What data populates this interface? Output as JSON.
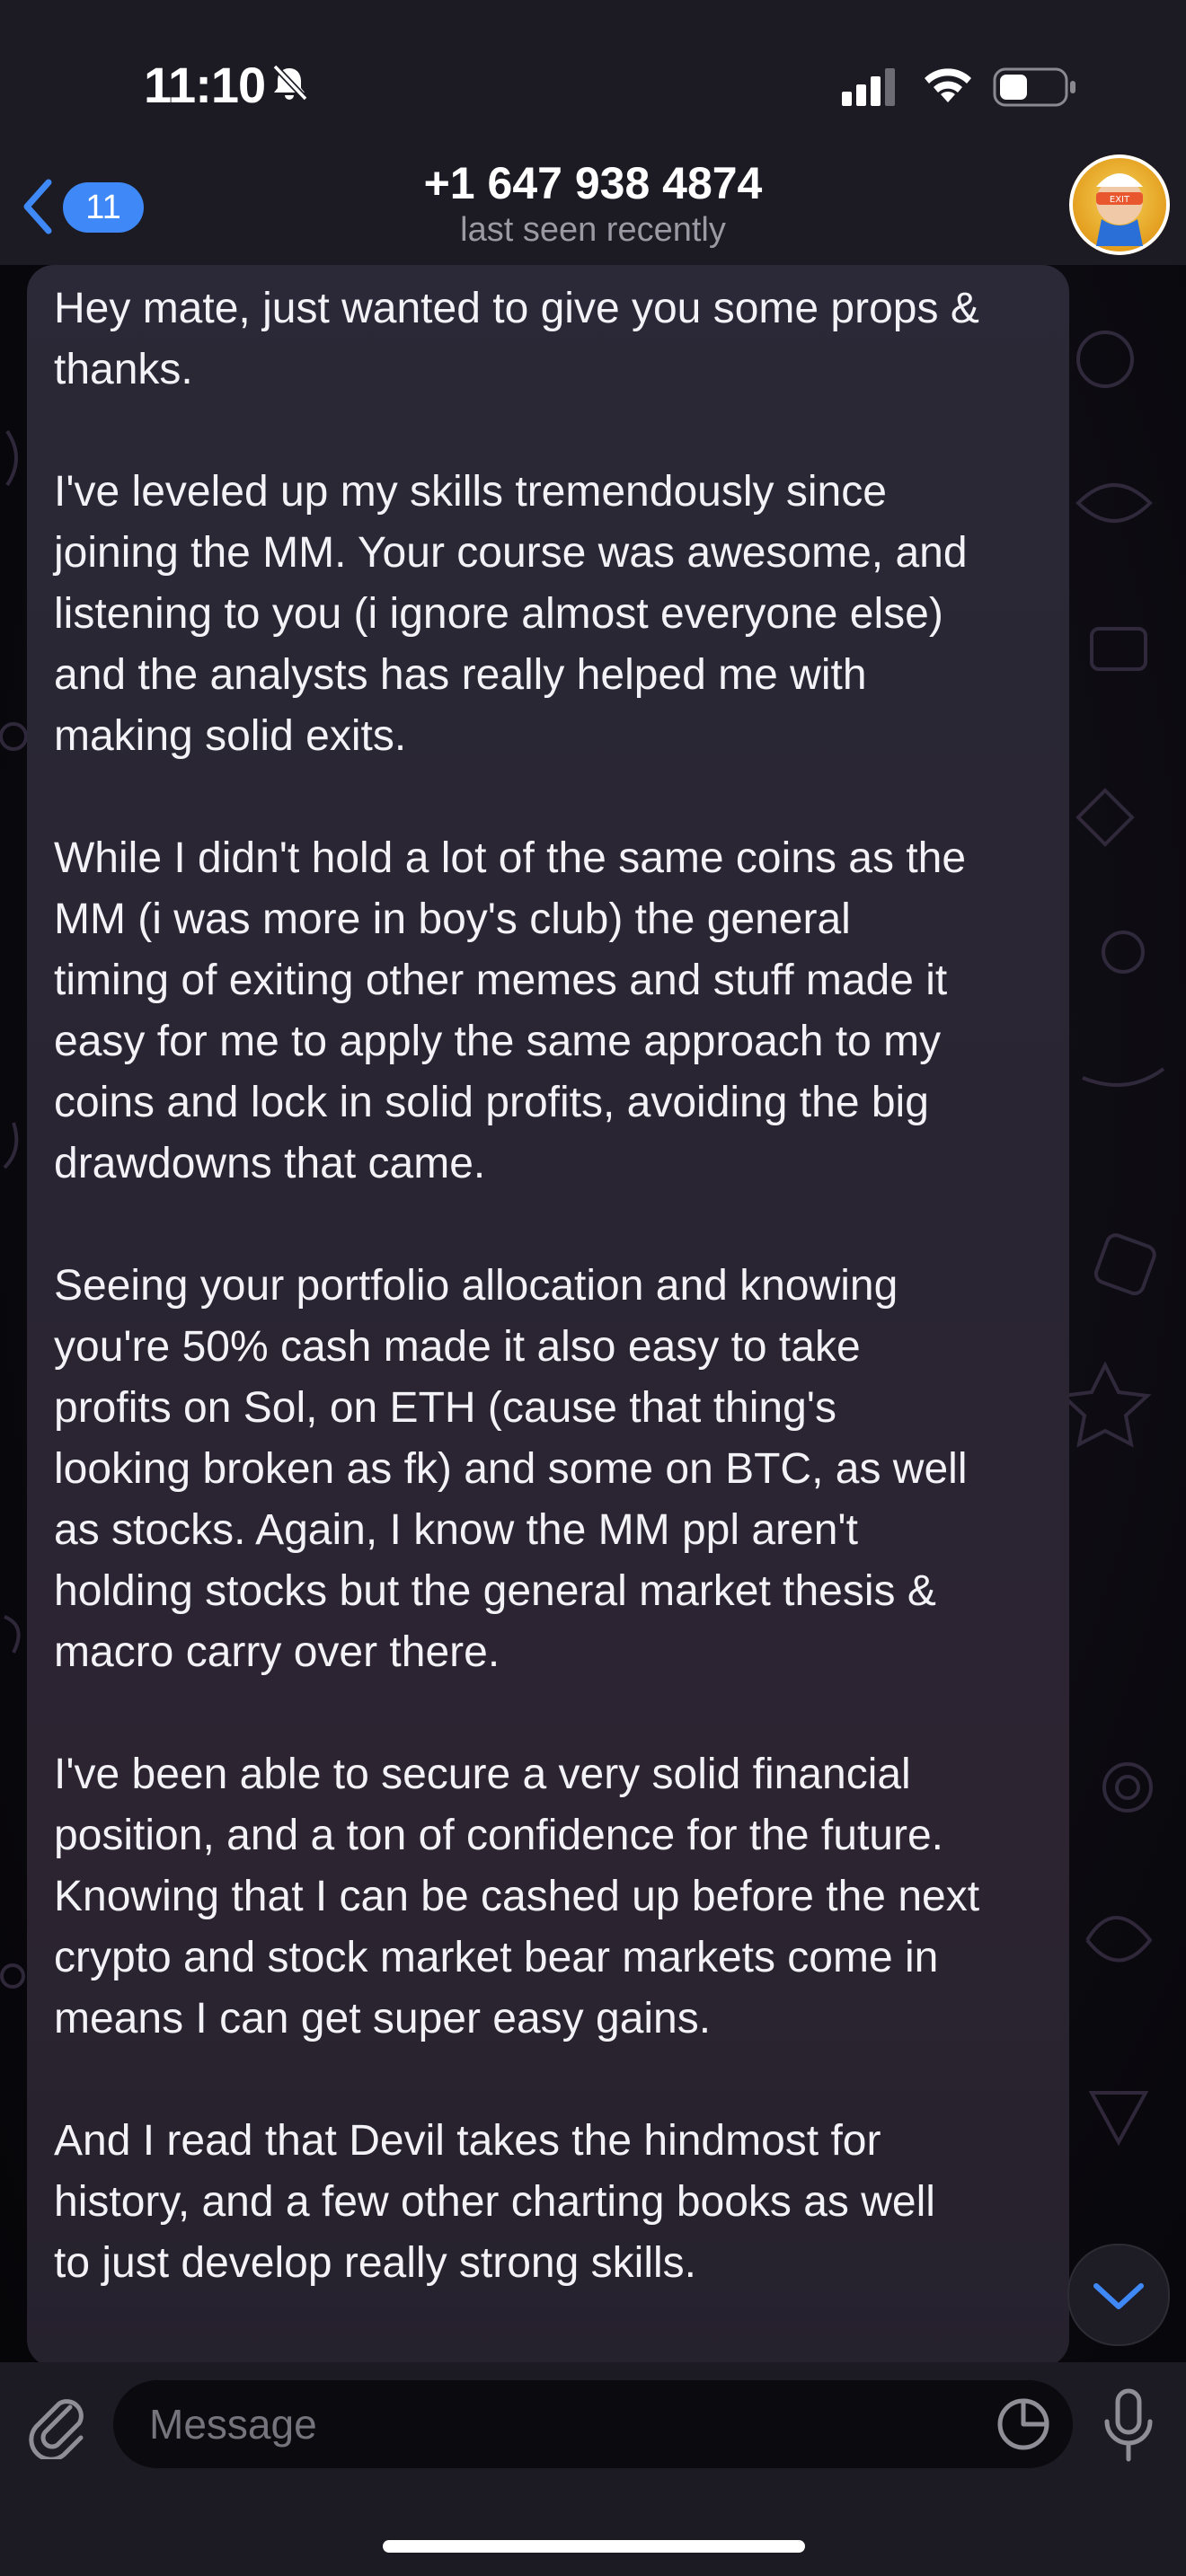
{
  "status_bar": {
    "time": "11:10"
  },
  "header": {
    "back_badge": "11",
    "contact_title": "+1 647 938 4874",
    "contact_status": "last seen recently"
  },
  "message": {
    "text": "Hey mate, just wanted to give you some props &\nthanks.\n\nI've leveled up my skills tremendously since\njoining the MM. Your course was awesome, and\nlistening to you (i ignore almost everyone else)\nand the analysts has really helped me with\nmaking solid exits.\n\nWhile I didn't hold a lot of the same coins as the\nMM (i was more in boy's club) the general\ntiming of exiting other memes and stuff made it\neasy for me to apply the same approach to my\ncoins and lock in solid profits, avoiding the big\ndrawdowns that came.\n\nSeeing your portfolio allocation and knowing\nyou're 50% cash made it also easy to take\nprofits on Sol, on ETH (cause that thing's\nlooking broken as fk) and some on BTC, as well\nas stocks. Again, I know the MM ppl aren't\nholding stocks but the general market thesis &\nmacro carry over there.\n\nI've been able to secure a very solid financial\nposition, and a ton of confidence for the future.\nKnowing that I can be cashed up before the next\ncrypto and stock market bear markets come in\nmeans I can get super easy gains.\n\nAnd I read that Devil takes the hindmost for\nhistory, and a few other charting books as well\nto just develop really strong skills."
  },
  "composer": {
    "placeholder": "Message"
  },
  "colors": {
    "accent": "#3e88f7",
    "bar_background": "#1c1b23",
    "bubble": "#2b2937"
  },
  "icons": {
    "status": [
      "bell-slash-icon",
      "cellular-signal-icon",
      "wifi-icon",
      "battery-icon"
    ],
    "header": [
      "chevron-left-icon",
      "avatar"
    ],
    "composer": [
      "paperclip-icon",
      "sticker-icon",
      "microphone-icon"
    ],
    "chat": [
      "chevron-down-icon"
    ]
  }
}
